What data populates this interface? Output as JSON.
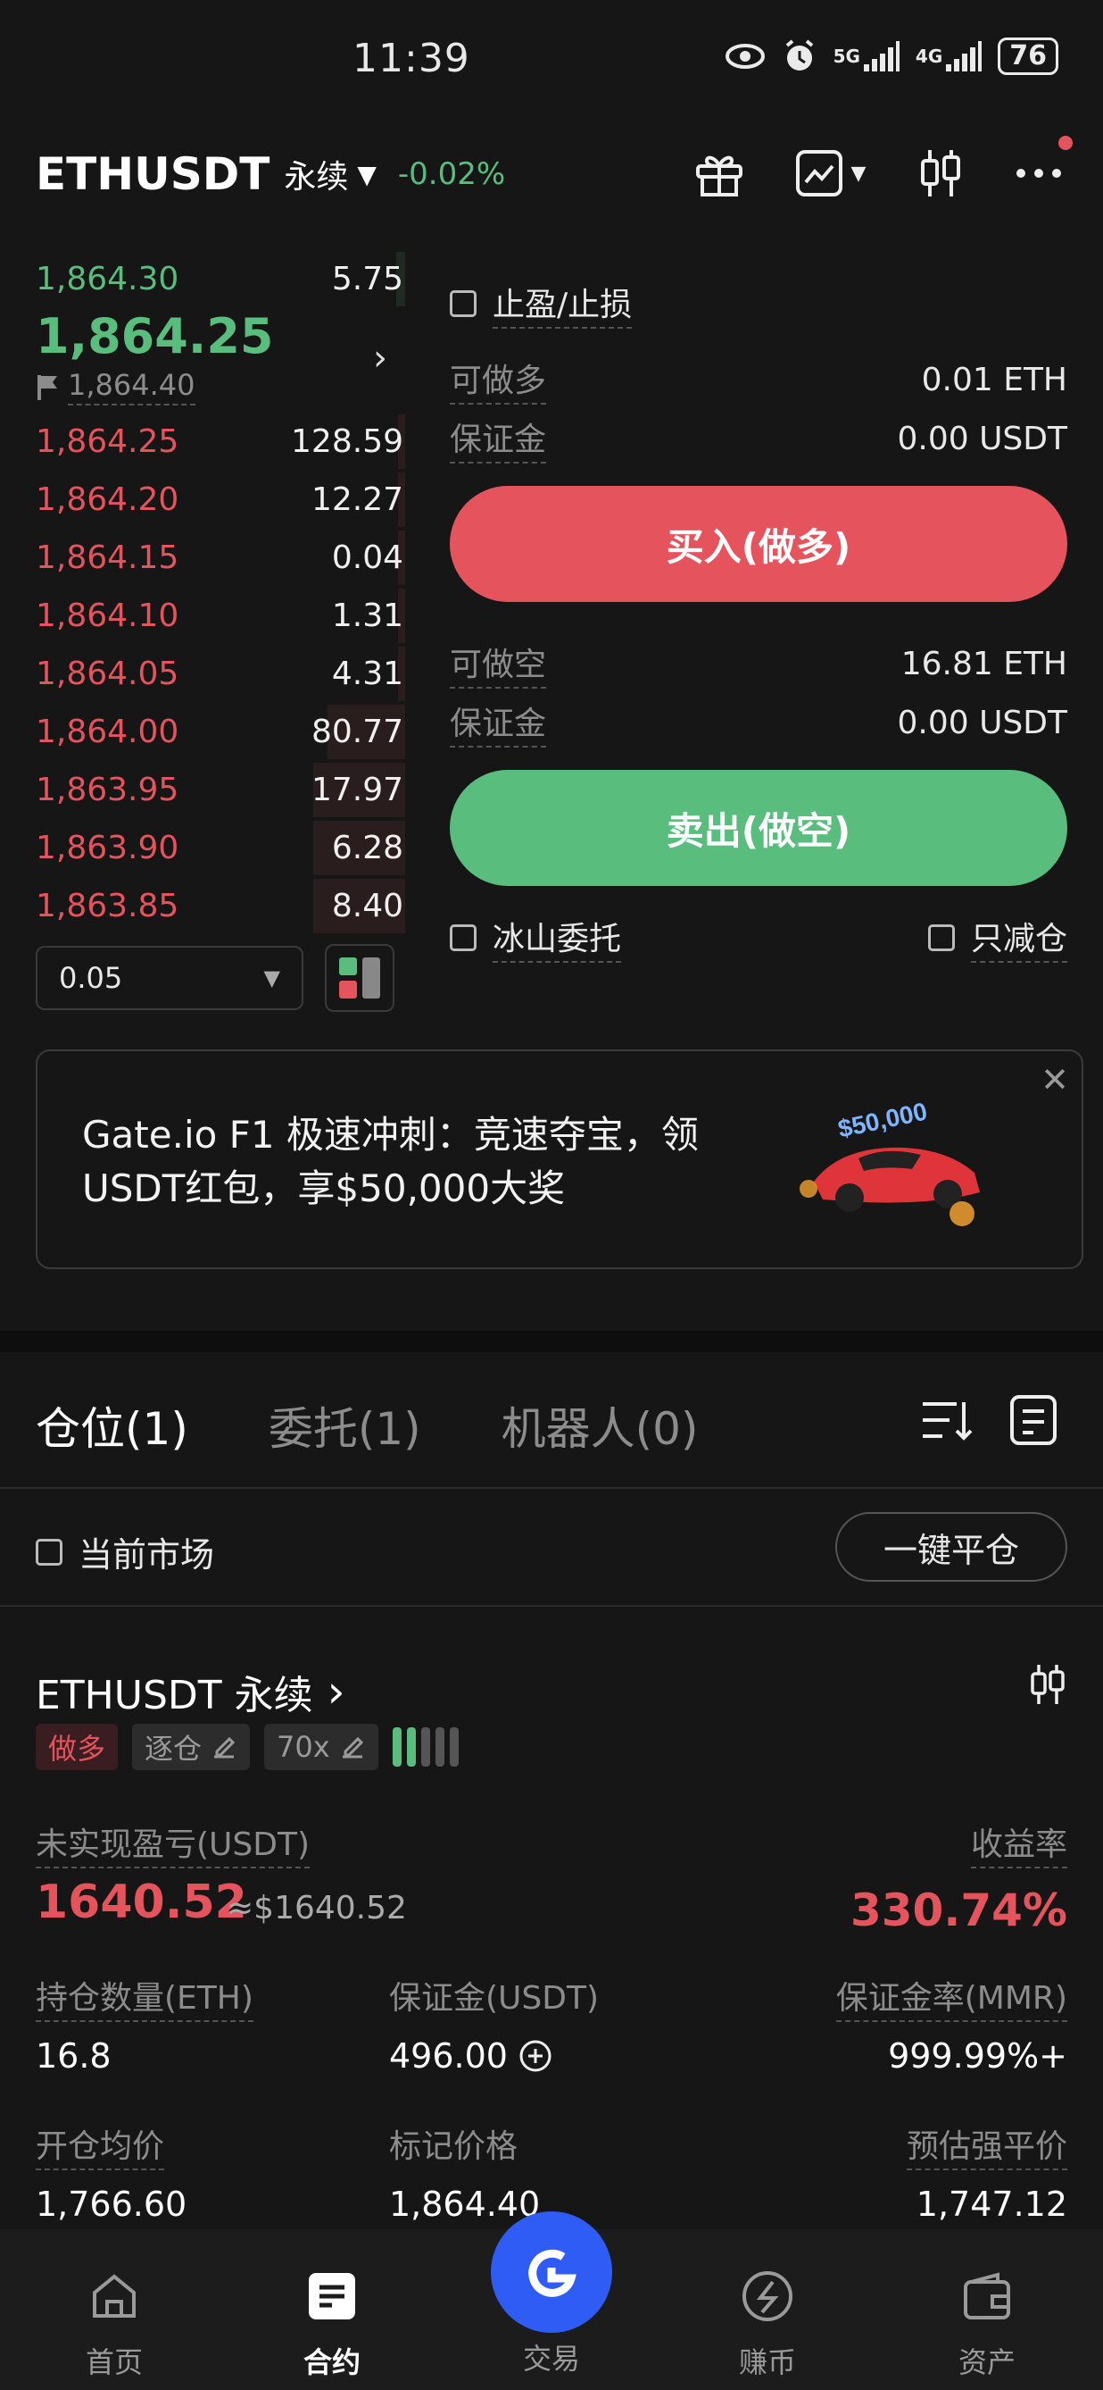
{
  "status_bar": {
    "time": "11:39",
    "net1": "5G",
    "net2": "4G",
    "battery": "76"
  },
  "header": {
    "symbol": "ETHUSDT",
    "contract_type": "永续",
    "change": "-0.02%"
  },
  "order_book": {
    "asks_top": {
      "price": "1,864.30",
      "qty": "5.75"
    },
    "last_price": "1,864.25",
    "mark_price": "1,864.40",
    "bids": [
      {
        "price": "1,864.25",
        "qty": "128.59",
        "depth": 0.02
      },
      {
        "price": "1,864.20",
        "qty": "12.27",
        "depth": 0.02
      },
      {
        "price": "1,864.15",
        "qty": "0.04",
        "depth": 0.02
      },
      {
        "price": "1,864.10",
        "qty": "1.31",
        "depth": 0.02
      },
      {
        "price": "1,864.05",
        "qty": "4.31",
        "depth": 0.02
      },
      {
        "price": "1,864.00",
        "qty": "80.77",
        "depth": 0.21
      },
      {
        "price": "1,863.95",
        "qty": "17.97",
        "depth": 0.25
      },
      {
        "price": "1,863.90",
        "qty": "6.28",
        "depth": 0.25
      },
      {
        "price": "1,863.85",
        "qty": "8.40",
        "depth": 0.25
      }
    ],
    "step": "0.05"
  },
  "trade_panel": {
    "tp_sl_label": "止盈/止损",
    "can_long_label": "可做多",
    "can_long_value": "0.01 ETH",
    "margin_label": "保证金",
    "margin_long_value": "0.00 USDT",
    "buy_button": "买入(做多)",
    "can_short_label": "可做空",
    "can_short_value": "16.81 ETH",
    "margin_short_value": "0.00 USDT",
    "sell_button": "卖出(做空)",
    "iceberg_label": "冰山委托",
    "reduce_only_label": "只减仓"
  },
  "banner": {
    "text": "Gate.io F1 极速冲刺：竞速夺宝，领USDT红包，享$50,000大奖",
    "art_text": "$50,000"
  },
  "tabs": [
    {
      "label": "仓位(1)"
    },
    {
      "label": "委托(1)"
    },
    {
      "label": "机器人(0)"
    }
  ],
  "filters": {
    "current_market_label": "当前市场",
    "close_all_button": "一键平仓"
  },
  "position": {
    "title": "ETHUSDT 永续",
    "side_tag": "做多",
    "margin_mode_tag": "逐仓",
    "leverage_tag": "70x",
    "unrealized_pnl_label": "未实现盈亏(USDT)",
    "unrealized_pnl": "1640.52",
    "unrealized_pnl_usd": "≈$1640.52",
    "roe_label": "收益率",
    "roe": "330.74%",
    "size_label": "持仓数量(ETH)",
    "size": "16.8",
    "margin_label": "保证金(USDT)",
    "margin": "496.00",
    "mmr_label": "保证金率(MMR)",
    "mmr": "999.99%+",
    "entry_label": "开仓均价",
    "entry": "1,766.60",
    "mark_label": "标记价格",
    "mark": "1,864.40",
    "liq_label": "预估强平价",
    "liq": "1,747.12"
  },
  "bottom_nav": [
    {
      "label": "首页"
    },
    {
      "label": "合约"
    },
    {
      "label": "交易"
    },
    {
      "label": "赚币"
    },
    {
      "label": "资产"
    }
  ],
  "colors": {
    "green": "#58bd7d",
    "red": "#e5535d",
    "blue": "#2f5cf4",
    "bg": "#161616"
  }
}
